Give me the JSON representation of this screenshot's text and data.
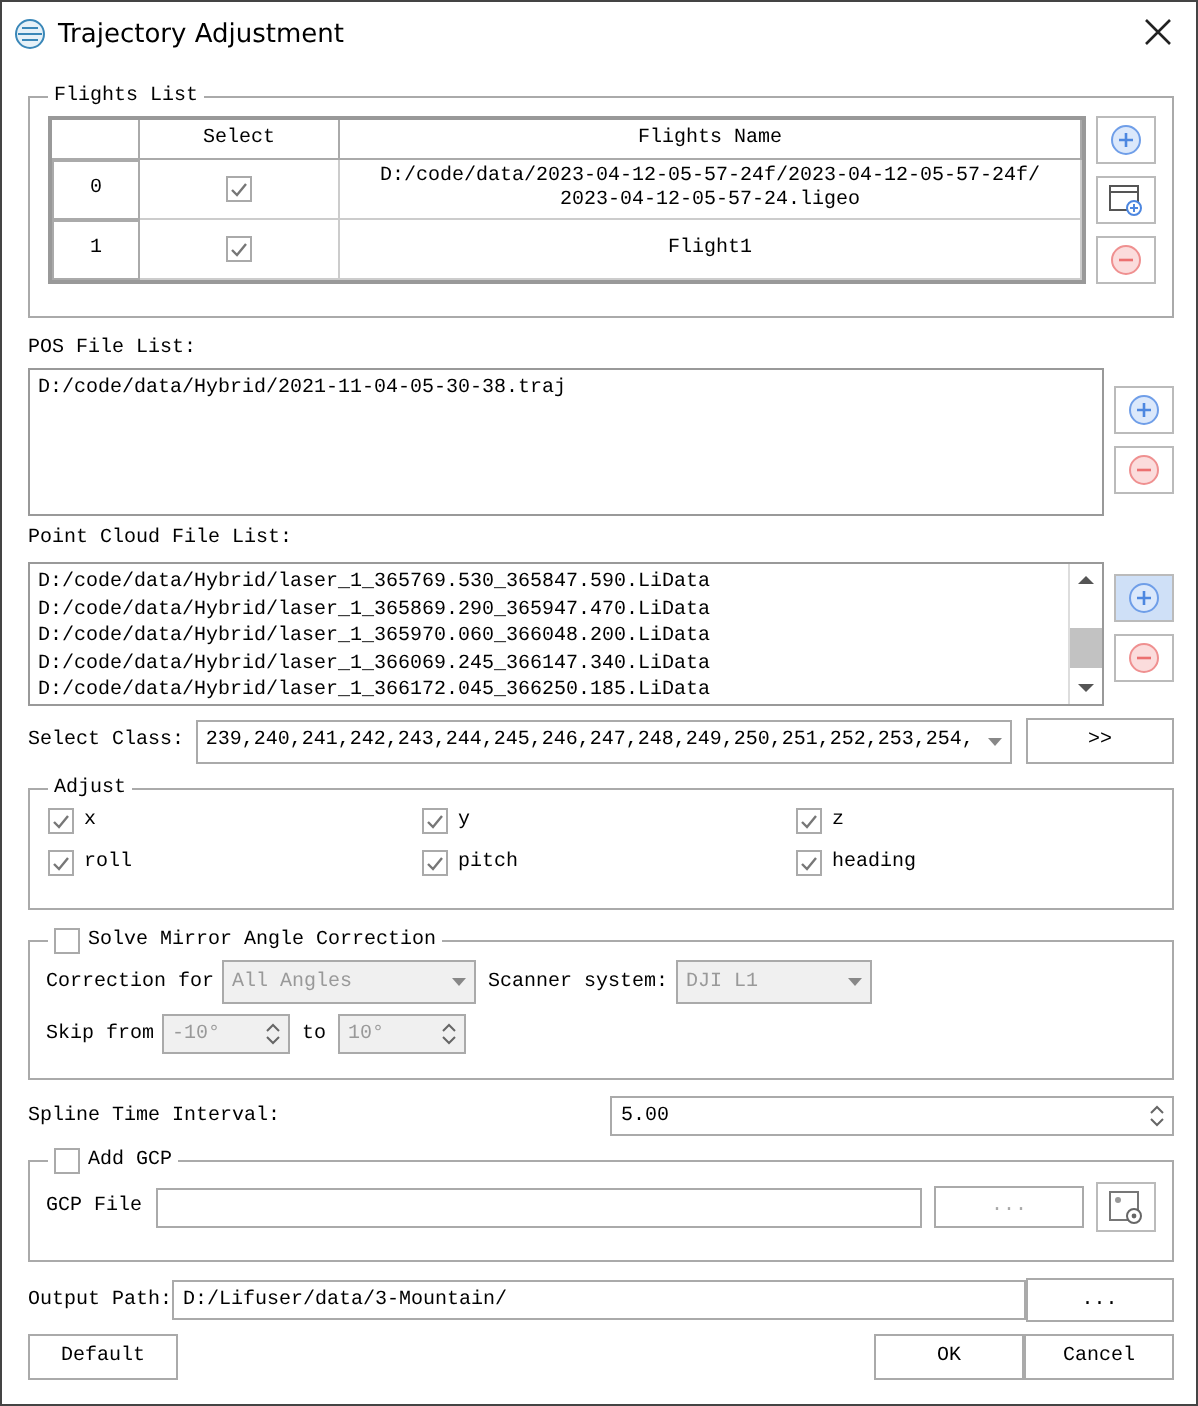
{
  "window": {
    "title": "Trajectory Adjustment"
  },
  "flights_list": {
    "title": "Flights List",
    "columns": [
      "Select",
      "Flights Name"
    ],
    "rows": [
      {
        "index": "0",
        "checked": true,
        "name_lines": [
          "D:/code/data/2023-04-12-05-57-24f/2023-04-12-05-57-24f/",
          "2023-04-12-05-57-24.ligeo"
        ]
      },
      {
        "index": "1",
        "checked": true,
        "name_lines": [
          "Flight1"
        ]
      }
    ]
  },
  "pos_files": {
    "label": "POS File List:",
    "items": [
      "D:/code/data/Hybrid/2021-11-04-05-30-38.traj"
    ]
  },
  "point_cloud_files": {
    "label": "Point Cloud File List:",
    "add_focused": true,
    "items": [
      "D:/code/data/Hybrid/laser_1_365769.530_365847.590.LiData",
      "D:/code/data/Hybrid/laser_1_365869.290_365947.470.LiData",
      "D:/code/data/Hybrid/laser_1_365970.060_366048.200.LiData",
      "D:/code/data/Hybrid/laser_1_366069.245_366147.340.LiData",
      "D:/code/data/Hybrid/laser_1_366172.045_366250.185.LiData"
    ]
  },
  "select_class": {
    "label": "Select Class:",
    "value": "239,240,241,242,243,244,245,246,247,248,249,250,251,252,253,254,",
    "button": ">>"
  },
  "adjust": {
    "title": "Adjust",
    "options": [
      {
        "label": "x",
        "checked": true
      },
      {
        "label": "y",
        "checked": true
      },
      {
        "label": "z",
        "checked": true
      },
      {
        "label": "roll",
        "checked": true
      },
      {
        "label": "pitch",
        "checked": true
      },
      {
        "label": "heading",
        "checked": true
      }
    ]
  },
  "mirror": {
    "label": "Solve Mirror Angle Correction",
    "checked": false,
    "correction_label": "Correction for",
    "correction_value": "All Angles",
    "scanner_label": "Scanner system:",
    "scanner_value": "DJI L1",
    "skip_label": "Skip from",
    "skip_from": "-10°",
    "to_label": "to",
    "skip_to": "10°"
  },
  "spline": {
    "label": "Spline Time Interval:",
    "value": "5.00"
  },
  "gcp": {
    "label": "Add GCP",
    "checked": false,
    "file_label": "GCP File",
    "browse": "...",
    "browse_disabled": true
  },
  "output": {
    "label": "Output Path:",
    "value": "D:/Lifuser/data/3-Mountain/",
    "browse": "..."
  },
  "buttons": [
    {
      "label": "Default",
      "kind": "left"
    },
    {
      "label": "OK",
      "kind": "right"
    },
    {
      "label": "Cancel",
      "kind": "right"
    }
  ]
}
